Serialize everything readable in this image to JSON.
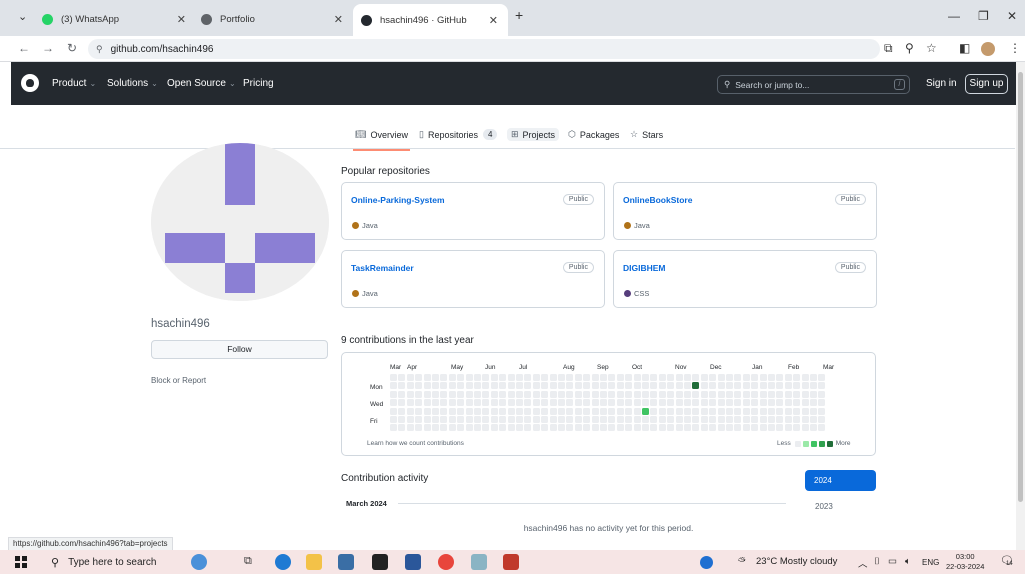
{
  "browser": {
    "tabs": [
      {
        "title": "(3) WhatsApp",
        "favicon_color": "#25d366"
      },
      {
        "title": "Portfolio",
        "favicon_color": "#5f6368"
      },
      {
        "title": "hsachin496 · GitHub",
        "favicon_color": "#24292f",
        "active": true
      }
    ],
    "url": "github.com/hsachin496",
    "status_url": "https://github.com/hsachin496?tab=projects"
  },
  "header": {
    "nav": [
      "Product",
      "Solutions",
      "Open Source",
      "Pricing"
    ],
    "search_placeholder": "Search or jump to...",
    "search_key": "/",
    "sign_in": "Sign in",
    "sign_up": "Sign up"
  },
  "profile_tabs": [
    {
      "label": "Overview",
      "icon": "book-icon",
      "active": true
    },
    {
      "label": "Repositories",
      "icon": "repo-icon",
      "count": "4"
    },
    {
      "label": "Projects",
      "icon": "table-icon"
    },
    {
      "label": "Packages",
      "icon": "package-icon"
    },
    {
      "label": "Stars",
      "icon": "star-icon"
    }
  ],
  "profile": {
    "username": "hsachin496",
    "follow_label": "Follow",
    "block_label": "Block or Report"
  },
  "popular": {
    "title": "Popular repositories",
    "repos": [
      {
        "name": "Online-Parking-System",
        "visibility": "Public",
        "language": "Java",
        "lang_color": "#b07219"
      },
      {
        "name": "OnlineBookStore",
        "visibility": "Public",
        "language": "Java",
        "lang_color": "#b07219"
      },
      {
        "name": "TaskRemainder",
        "visibility": "Public",
        "language": "Java",
        "lang_color": "#b07219"
      },
      {
        "name": "DIGIBHEM",
        "visibility": "Public",
        "language": "CSS",
        "lang_color": "#563d7c"
      }
    ]
  },
  "contributions": {
    "title": "9 contributions in the last year",
    "months": [
      "Mar",
      "Apr",
      "May",
      "Jun",
      "Jul",
      "Aug",
      "Sep",
      "Oct",
      "Nov",
      "Dec",
      "Jan",
      "Feb",
      "Mar"
    ],
    "days": [
      "Mon",
      "Wed",
      "Fri"
    ],
    "learn_label": "Learn how we count contributions",
    "legend_less": "Less",
    "legend_more": "More",
    "level_colors": [
      "#ebedf0",
      "#9be9a8",
      "#40c463",
      "#30a14e",
      "#216e39"
    ]
  },
  "activity": {
    "title": "Contribution activity",
    "years": [
      "2024",
      "2023"
    ],
    "month_heading": "March 2024",
    "empty_message": "hsachin496 has no activity yet for this period."
  },
  "taskbar": {
    "search_placeholder": "Type here to search",
    "weather": "23°C  Mostly cloudy",
    "language": "ENG",
    "time": "03:00",
    "date": "22-03-2024",
    "notifications": "14"
  }
}
